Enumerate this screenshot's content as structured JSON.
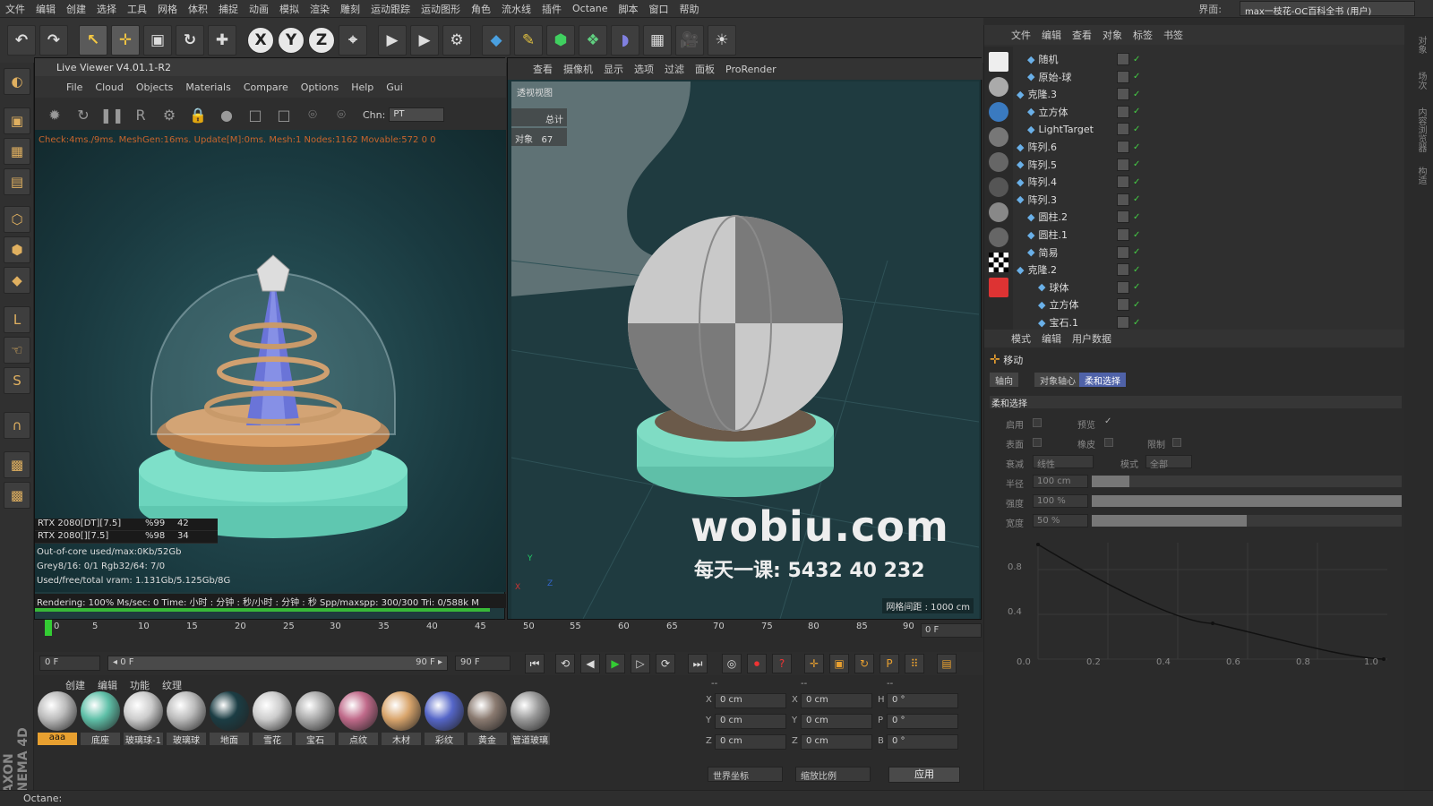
{
  "menubar": {
    "items": [
      "文件",
      "编辑",
      "创建",
      "选择",
      "工具",
      "网格",
      "体积",
      "捕捉",
      "动画",
      "模拟",
      "渲染",
      "雕刻",
      "运动跟踪",
      "运动图形",
      "角色",
      "流水线",
      "插件",
      "Octane",
      "脚本",
      "窗口",
      "帮助"
    ],
    "layout_label": "界面:",
    "layout_value": "max一枝花-OC百科全书 (用户)"
  },
  "toolbar": {
    "undo": "↶",
    "redo": "↷",
    "select": "↖",
    "move": "✛",
    "scale": "▣",
    "rotate": "↻",
    "add": "✚",
    "x": "X",
    "y": "Y",
    "z": "Z",
    "world": "⌖",
    "render_view": "▶",
    "render_pic": "▶",
    "render_settings": "⚙",
    "cube": "◆",
    "pen": "✎",
    "subdiv": "⬢",
    "clone": "❖",
    "deform": "◗",
    "floor": "▦",
    "camera": "🎥",
    "light": "☀"
  },
  "live_viewer": {
    "title": "Live Viewer V4.01.1-R2",
    "menu": [
      "File",
      "Cloud",
      "Objects",
      "Materials",
      "Compare",
      "Options",
      "Help",
      "Gui"
    ],
    "chn_label": "Chn:",
    "chn_value": "PT",
    "status": "Check:4ms./9ms. MeshGen:16ms. Update[M]:0ms. Mesh:1 Nodes:1162 Movable:572  0 0",
    "gpus": [
      {
        "name": "RTX 2080[DT][7.5]",
        "pct": "%99",
        "val": "42"
      },
      {
        "name": "RTX 2080[][7.5]",
        "pct": "%98",
        "val": "34"
      }
    ],
    "info": [
      "Out-of-core used/max:0Kb/52Gb",
      "Grey8/16: 0/1          Rgb32/64: 7/0",
      "Used/free/total vram: 1.131Gb/5.125Gb/8G"
    ],
    "render_line": "Rendering: 100%    Ms/sec: 0   Time: 小时 : 分钟 : 秒/小时 : 分钟 : 秒   Spp/maxspp: 300/300      Tri: 0/588k     M",
    "progress": 0.97
  },
  "viewport": {
    "menu": [
      "查看",
      "摄像机",
      "显示",
      "选项",
      "过滤",
      "面板",
      "ProRender"
    ],
    "label": "透视视图",
    "total_label": "总计",
    "objects_label": "对象",
    "objects_value": "67",
    "grid_text": "网格间距 : 1000 cm",
    "watermark1": "wobiu.com",
    "watermark2": "每天一课: 5432 40 232",
    "axis_x": "X",
    "axis_y": "Y",
    "axis_z": "Z"
  },
  "timeline": {
    "ticks": [
      "0",
      "5",
      "10",
      "15",
      "20",
      "25",
      "30",
      "35",
      "40",
      "45",
      "50",
      "55",
      "60",
      "65",
      "70",
      "75",
      "80",
      "85",
      "90"
    ],
    "current_frame": "0 F",
    "start_field": "0 F",
    "range_start": "◂ 0 F",
    "range_end": "90 F ▸",
    "end_field": "90 F"
  },
  "transport": {
    "buttons": [
      "⏮",
      "⟲",
      "◀",
      "▶",
      "▷",
      "⟳",
      "⏭"
    ],
    "record_buttons": [
      "◎",
      "⏺",
      "?",
      "✛",
      "▣",
      "↻",
      "P",
      "⠿",
      "▤"
    ]
  },
  "materials": {
    "menu": [
      "创建",
      "编辑",
      "功能",
      "纹理"
    ],
    "items": [
      {
        "name": "aaa",
        "color": "#bbbbbb",
        "selected": true
      },
      {
        "name": "底座",
        "color": "#5fc0a8"
      },
      {
        "name": "玻璃球-1",
        "color": "#cccccc"
      },
      {
        "name": "玻璃球",
        "color": "#bbbbbb"
      },
      {
        "name": "地面",
        "color": "#1b3d44"
      },
      {
        "name": "雪花",
        "color": "#cccccc"
      },
      {
        "name": "宝石",
        "color": "#aaaaaa"
      },
      {
        "name": "点纹",
        "color": "#c06a8a"
      },
      {
        "name": "木材",
        "color": "#d9a56c"
      },
      {
        "name": "彩纹",
        "color": "#5566c8"
      },
      {
        "name": "黄金",
        "color": "#8a7a70"
      },
      {
        "name": "管道玻璃",
        "color": "#999999"
      }
    ]
  },
  "coords": {
    "headers": [
      "--",
      "--",
      "--"
    ],
    "rows": [
      {
        "l1": "X",
        "v1": "0 cm",
        "l2": "X",
        "v2": "0 cm",
        "l3": "H",
        "v3": "0 °"
      },
      {
        "l1": "Y",
        "v1": "0 cm",
        "l2": "Y",
        "v2": "0 cm",
        "l3": "P",
        "v3": "0 °"
      },
      {
        "l1": "Z",
        "v1": "0 cm",
        "l2": "Z",
        "v2": "0 cm",
        "l3": "B",
        "v3": "0 °"
      }
    ],
    "mode1": "世界坐标",
    "mode2": "缩放比例",
    "apply": "应用"
  },
  "object_manager": {
    "menu": [
      "文件",
      "编辑",
      "查看",
      "对象",
      "标签",
      "书签"
    ],
    "objects": [
      {
        "name": "随机",
        "indent": 1
      },
      {
        "name": "原始-球",
        "indent": 1
      },
      {
        "name": "克隆.3",
        "indent": 0
      },
      {
        "name": "立方体",
        "indent": 1
      },
      {
        "name": "LightTarget",
        "indent": 1
      },
      {
        "name": "阵列.6",
        "indent": 0
      },
      {
        "name": "阵列.5",
        "indent": 0
      },
      {
        "name": "阵列.4",
        "indent": 0
      },
      {
        "name": "阵列.3",
        "indent": 0
      },
      {
        "name": "圆柱.2",
        "indent": 1
      },
      {
        "name": "圆柱.1",
        "indent": 1
      },
      {
        "name": "简易",
        "indent": 1
      },
      {
        "name": "克隆.2",
        "indent": 0
      },
      {
        "name": "球体",
        "indent": 2
      },
      {
        "name": "立方体",
        "indent": 2
      },
      {
        "name": "宝石.1",
        "indent": 2
      }
    ]
  },
  "attributes": {
    "menu": [
      "模式",
      "编辑",
      "用户数据"
    ],
    "mode_title": "移动",
    "tabs": [
      "轴向",
      "对象轴心",
      "柔和选择"
    ],
    "active_tab": 2,
    "section": "柔和选择",
    "enable_label": "启用",
    "preview_label": "预览",
    "surface_label": "表面",
    "rubber_label": "橡皮",
    "restrict_label": "限制",
    "falloff_label": "衰减",
    "falloff_value": "线性",
    "mode_label": "模式",
    "mode_value": "全部",
    "radius_label": "半径",
    "radius_value": "100 cm",
    "radius_frac": 0.12,
    "strength_label": "强度",
    "strength_value": "100 %",
    "strength_frac": 1.0,
    "width_label": "宽度",
    "width_value": "50 %",
    "width_frac": 0.5,
    "curve_y_ticks": [
      "0.8",
      "0.4"
    ],
    "curve_x_ticks": [
      "0.0",
      "0.2",
      "0.4",
      "0.6",
      "0.8",
      "1.0"
    ]
  },
  "statusbar": "Octane:",
  "right_strip": [
    "对象",
    "场次",
    "内容浏览器",
    "构造"
  ]
}
